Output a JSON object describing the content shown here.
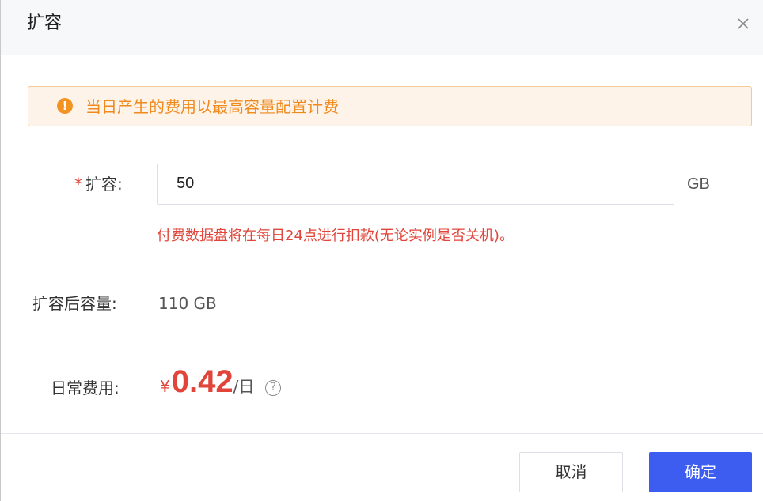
{
  "dialog": {
    "title": "扩容",
    "close_icon": "close-icon"
  },
  "alert": {
    "icon": "exclamation-circle-icon",
    "icon_glyph": "!",
    "text": "当日产生的费用以最高容量配置计费",
    "color": "#f08a1d"
  },
  "form": {
    "expand": {
      "required_mark": "*",
      "label": "扩容:",
      "value": "50",
      "unit": "GB",
      "hint": "付费数据盘将在每日24点进行扣款(无论实例是否关机)。"
    },
    "capacity_after": {
      "label": "扩容后容量:",
      "value": "110 GB"
    },
    "daily_cost": {
      "label": "日常费用:",
      "currency": "¥",
      "amount": "0.42",
      "unit": "/日",
      "help_icon": "question-circle-icon",
      "help_glyph": "?"
    }
  },
  "footer": {
    "cancel_label": "取消",
    "confirm_label": "确定"
  },
  "colors": {
    "primary": "#3d5cf0",
    "danger": "#e0443a",
    "warning": "#f39321"
  }
}
